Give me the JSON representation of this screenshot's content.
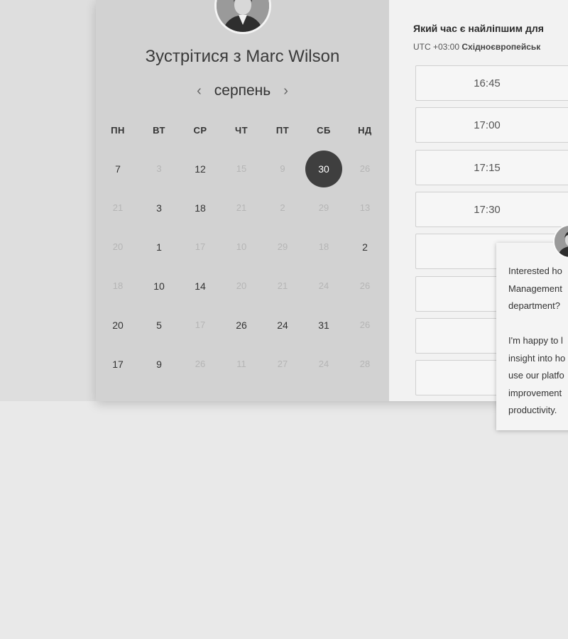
{
  "host": {
    "title": "Зустрітися з Marc Wilson"
  },
  "calendar": {
    "month": "серпень",
    "prev_icon": "chevron-left-icon",
    "next_icon": "chevron-right-icon",
    "weekdays": [
      "ПН",
      "ВТ",
      "СР",
      "ЧТ",
      "ПТ",
      "СБ",
      "НД"
    ],
    "weeks": [
      [
        {
          "d": "7",
          "s": "on"
        },
        {
          "d": "3",
          "s": "off"
        },
        {
          "d": "12",
          "s": "on"
        },
        {
          "d": "15",
          "s": "off"
        },
        {
          "d": "9",
          "s": "off"
        },
        {
          "d": "30",
          "s": "selected"
        },
        {
          "d": "26",
          "s": "off"
        }
      ],
      [
        {
          "d": "21",
          "s": "off"
        },
        {
          "d": "3",
          "s": "on"
        },
        {
          "d": "18",
          "s": "on"
        },
        {
          "d": "21",
          "s": "off"
        },
        {
          "d": "2",
          "s": "off"
        },
        {
          "d": "29",
          "s": "off"
        },
        {
          "d": "13",
          "s": "off"
        }
      ],
      [
        {
          "d": "20",
          "s": "off"
        },
        {
          "d": "1",
          "s": "on"
        },
        {
          "d": "17",
          "s": "off"
        },
        {
          "d": "10",
          "s": "off"
        },
        {
          "d": "29",
          "s": "off"
        },
        {
          "d": "18",
          "s": "off"
        },
        {
          "d": "2",
          "s": "on"
        }
      ],
      [
        {
          "d": "18",
          "s": "off"
        },
        {
          "d": "10",
          "s": "on"
        },
        {
          "d": "14",
          "s": "on"
        },
        {
          "d": "20",
          "s": "off"
        },
        {
          "d": "21",
          "s": "off"
        },
        {
          "d": "24",
          "s": "off"
        },
        {
          "d": "26",
          "s": "off"
        }
      ],
      [
        {
          "d": "20",
          "s": "on"
        },
        {
          "d": "5",
          "s": "on"
        },
        {
          "d": "17",
          "s": "off"
        },
        {
          "d": "26",
          "s": "on"
        },
        {
          "d": "24",
          "s": "on"
        },
        {
          "d": "31",
          "s": "on"
        },
        {
          "d": "26",
          "s": "off"
        }
      ],
      [
        {
          "d": "17",
          "s": "on"
        },
        {
          "d": "9",
          "s": "on"
        },
        {
          "d": "26",
          "s": "off"
        },
        {
          "d": "11",
          "s": "off"
        },
        {
          "d": "27",
          "s": "off"
        },
        {
          "d": "24",
          "s": "off"
        },
        {
          "d": "28",
          "s": "off"
        }
      ]
    ]
  },
  "timezone": {
    "question": "Який час є найліпшим для",
    "offset": "UTC +03:00",
    "zone_name": "Східноєвропейськ"
  },
  "slots": [
    "16:45",
    "17:00",
    "17:15",
    "17:30",
    "",
    "",
    "",
    ""
  ],
  "chat": {
    "lines_1": [
      "Interested ho",
      "Management",
      "department?"
    ],
    "lines_2": [
      "I'm happy to l",
      "insight into ho",
      "use our platfo",
      "improvement",
      "productivity."
    ]
  }
}
